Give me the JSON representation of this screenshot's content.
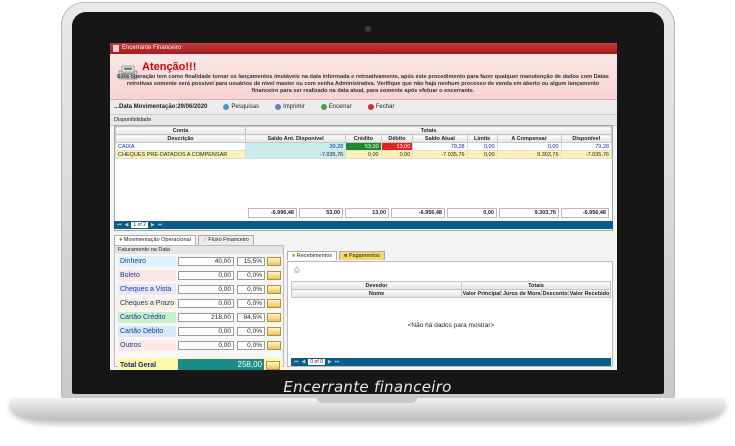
{
  "window": {
    "title": "Encerrante Financeiro"
  },
  "alert": {
    "title": "Atenção!!!",
    "text": "Esta operação tem como finalidade tornar os lançamentos imutáveis na data informada e retroativamente, após este procedimento para fazer qualquer manutenção de dados com  Datas retrotivas somente será possível para usuários de nível master ou com senha Administrativa. Verifique que não haja nenhum processo de venda em aberto ou algum lançamento financeiro para ser realizado na data atual, para somente após efetuar o encerrante."
  },
  "toolbar": {
    "data_label": "...Data Movimentação:29/06/2020",
    "pesquisas": "Pesquisas",
    "imprimir": "Imprimir",
    "encerrar": "Encerrar",
    "fechar": "Fechar"
  },
  "disponibilidade": {
    "label": "Disponibilidade",
    "group_conta": "Conta",
    "group_totais": "Totais",
    "columns": [
      "Descrição",
      "Saldo Ant. Disponível",
      "Crédito",
      "Débito",
      "Saldo Atual",
      "Limite",
      "A Compensar",
      "Disponível"
    ],
    "rows": [
      [
        "CAIXA",
        "39,28",
        "53,00",
        "13,00",
        "79,28",
        "0,00",
        "0,00",
        "79,28"
      ],
      [
        "CHEQUES PRE-DATADOS A COMPENSAR",
        "-7.035,76",
        "0,00",
        "0,00",
        "-7.035,76",
        "0,00",
        "9.303,76",
        "-7.035,76"
      ]
    ],
    "totals": [
      "-6.996,48",
      "53,00",
      "13,00",
      "-6.956,48",
      "0,00",
      "9.303,76",
      "-6.956,48"
    ],
    "page_info": "1 of 2"
  },
  "left_tabs": [
    "Movimentação Operacional",
    "Fluxo Financeiro"
  ],
  "faturamento": {
    "label": "Faturamento na Data",
    "rows": [
      {
        "label": "Dinheiro",
        "value": "40,00",
        "pct": "15,5%",
        "color": "#dff3ff"
      },
      {
        "label": "Boleto",
        "value": "0,00",
        "pct": "0,0%",
        "color": "#fde8e8"
      },
      {
        "label": "Cheques a Vista",
        "value": "0,00",
        "pct": "0,0%",
        "color": "#e8e8f8"
      },
      {
        "label": "Cheques a Prazo",
        "value": "0,00",
        "pct": "0,0%",
        "color": "#fdf0d8"
      },
      {
        "label": "Cartão Crédito",
        "value": "218,00",
        "pct": "84,5%",
        "color": "#c8f0c8"
      },
      {
        "label": "Cartão Débito",
        "value": "0,00",
        "pct": "0,0%",
        "color": "#d8e8f8"
      },
      {
        "label": "Outros",
        "value": "0,00",
        "pct": "0,0%",
        "color": "#ffe8e8"
      }
    ],
    "total_label": "Total Geral",
    "total_value": "258,00"
  },
  "right_tabs": [
    "Recebimentos",
    "Pagamentos"
  ],
  "recebimentos": {
    "group_devedor": "Devedor",
    "group_totais": "Totais",
    "columns": [
      "Nome",
      "Valor Principal",
      "Juros de Mora",
      "Desconto",
      "Valor Recebido"
    ],
    "empty": "<Não há dados para mostrar>",
    "page_info": "0 of 0"
  },
  "caption": "Encerrante financeiro"
}
